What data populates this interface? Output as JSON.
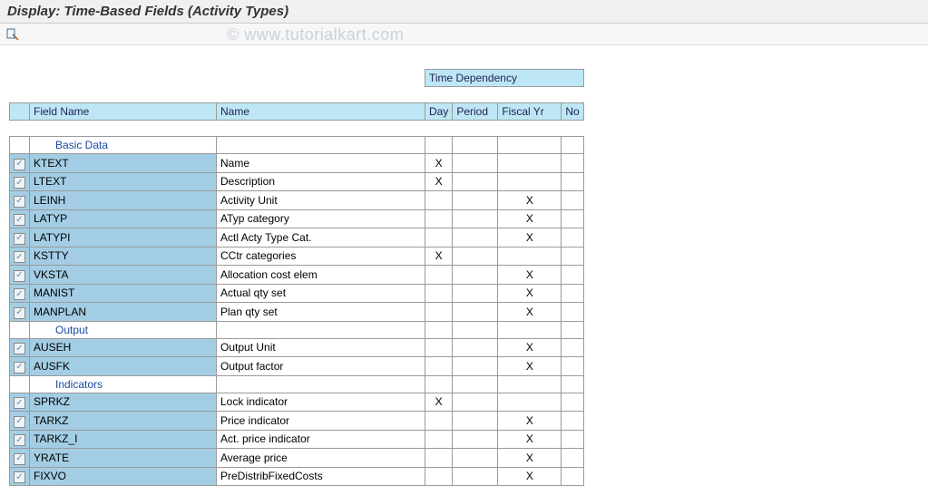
{
  "title": "Display: Time-Based Fields (Activity Types)",
  "watermark": "© www.tutorialkart.com",
  "headers": {
    "time_dependency": "Time Dependency",
    "field_name": "Field Name",
    "name": "Name",
    "day": "Day",
    "period": "Period",
    "fiscal_yr": "Fiscal Yr",
    "no": "No"
  },
  "groups": [
    {
      "label": "Basic Data",
      "rows": [
        {
          "field": "KTEXT",
          "name": "Name",
          "day": "X",
          "period": "",
          "fiscal": "",
          "no": ""
        },
        {
          "field": "LTEXT",
          "name": "Description",
          "day": "X",
          "period": "",
          "fiscal": "",
          "no": ""
        },
        {
          "field": "LEINH",
          "name": "Activity Unit",
          "day": "",
          "period": "",
          "fiscal": "X",
          "no": ""
        },
        {
          "field": "LATYP",
          "name": "ATyp category",
          "day": "",
          "period": "",
          "fiscal": "X",
          "no": ""
        },
        {
          "field": "LATYPI",
          "name": "Actl Acty Type Cat.",
          "day": "",
          "period": "",
          "fiscal": "X",
          "no": ""
        },
        {
          "field": "KSTTY",
          "name": "CCtr categories",
          "day": "X",
          "period": "",
          "fiscal": "",
          "no": ""
        },
        {
          "field": "VKSTA",
          "name": "Allocation cost elem",
          "day": "",
          "period": "",
          "fiscal": "X",
          "no": ""
        },
        {
          "field": "MANIST",
          "name": "Actual qty set",
          "day": "",
          "period": "",
          "fiscal": "X",
          "no": ""
        },
        {
          "field": "MANPLAN",
          "name": "Plan qty set",
          "day": "",
          "period": "",
          "fiscal": "X",
          "no": ""
        }
      ]
    },
    {
      "label": "Output",
      "rows": [
        {
          "field": "AUSEH",
          "name": "Output Unit",
          "day": "",
          "period": "",
          "fiscal": "X",
          "no": ""
        },
        {
          "field": "AUSFK",
          "name": "Output factor",
          "day": "",
          "period": "",
          "fiscal": "X",
          "no": ""
        }
      ]
    },
    {
      "label": "Indicators",
      "rows": [
        {
          "field": "SPRKZ",
          "name": "Lock indicator",
          "day": "X",
          "period": "",
          "fiscal": "",
          "no": ""
        },
        {
          "field": "TARKZ",
          "name": "Price indicator",
          "day": "",
          "period": "",
          "fiscal": "X",
          "no": ""
        },
        {
          "field": "TARKZ_I",
          "name": "Act. price indicator",
          "day": "",
          "period": "",
          "fiscal": "X",
          "no": ""
        },
        {
          "field": "YRATE",
          "name": "Average price",
          "day": "",
          "period": "",
          "fiscal": "X",
          "no": ""
        },
        {
          "field": "FIXVO",
          "name": "PreDistribFixedCosts",
          "day": "",
          "period": "",
          "fiscal": "X",
          "no": ""
        }
      ]
    }
  ]
}
